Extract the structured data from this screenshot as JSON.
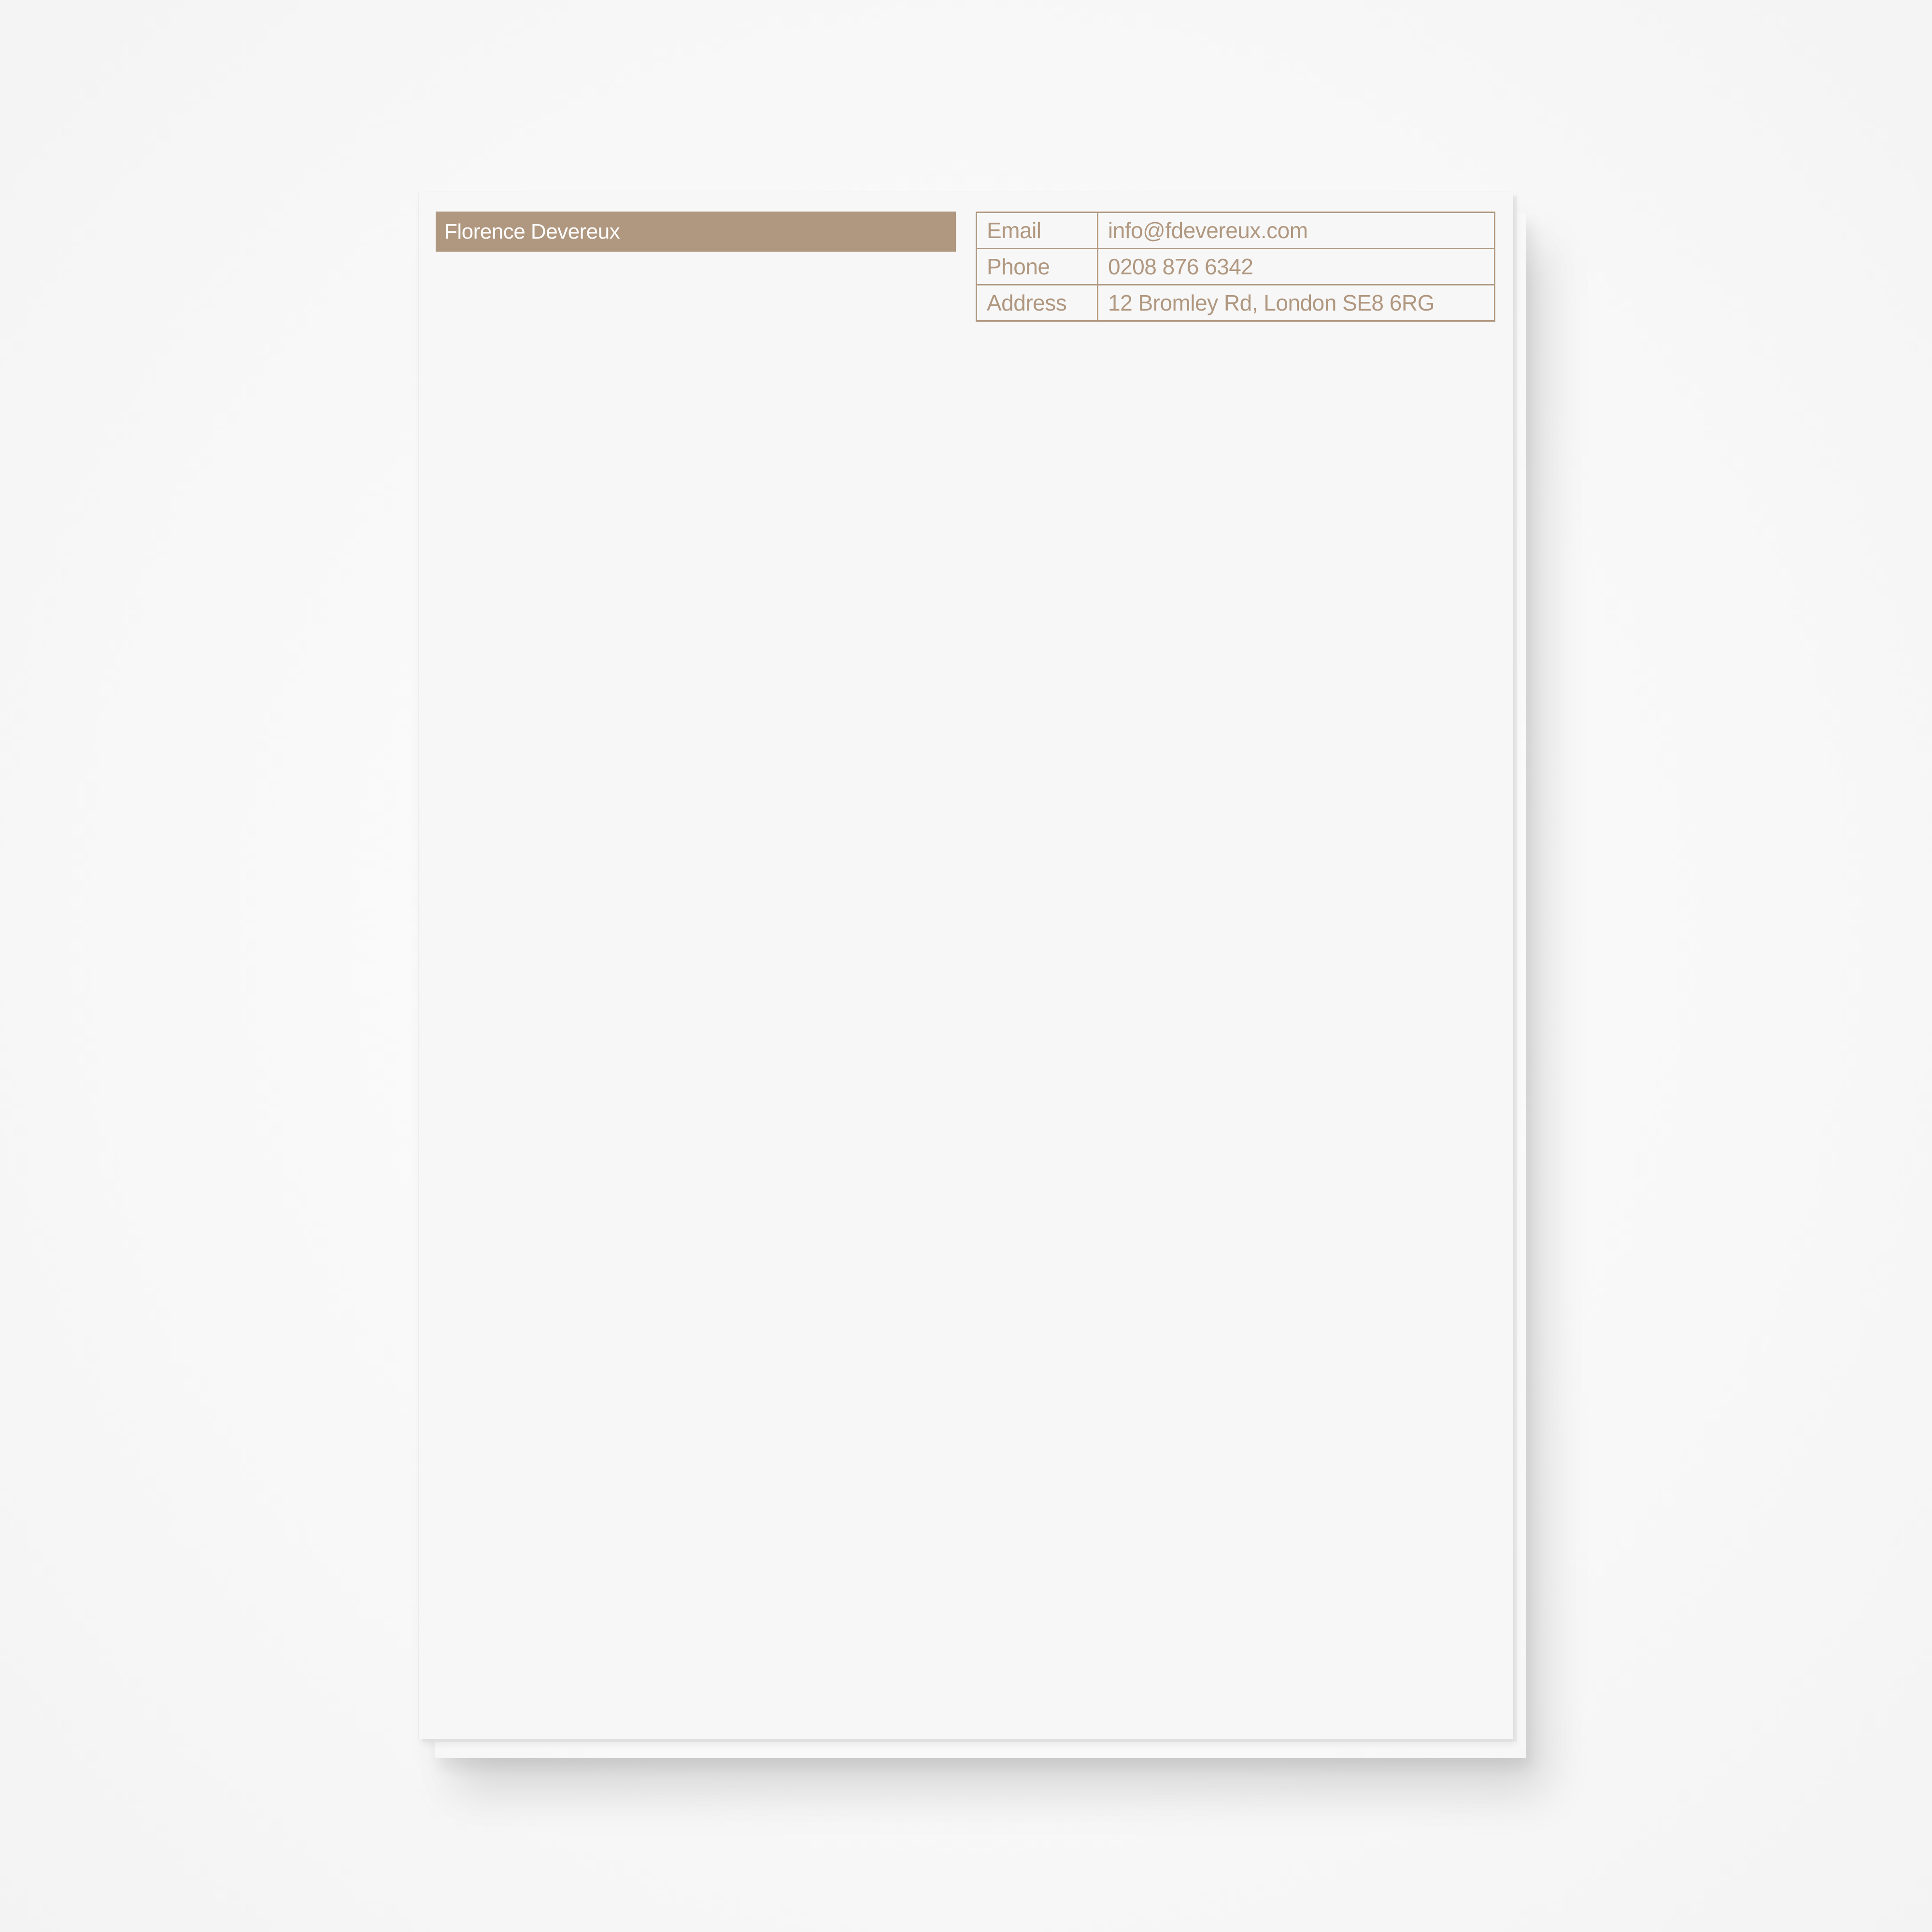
{
  "letterhead": {
    "name": "Florence Devereux",
    "contact": [
      {
        "label": "Email",
        "value": "info@fdevereux.com"
      },
      {
        "label": "Phone",
        "value": " 0208 876 6342"
      },
      {
        "label": "Address",
        "value": "12 Bromley Rd, London SE8 6RG"
      }
    ]
  },
  "colors": {
    "accent": "#b0977f",
    "paper": "#f7f7f7",
    "background": "#fbfbfb"
  }
}
